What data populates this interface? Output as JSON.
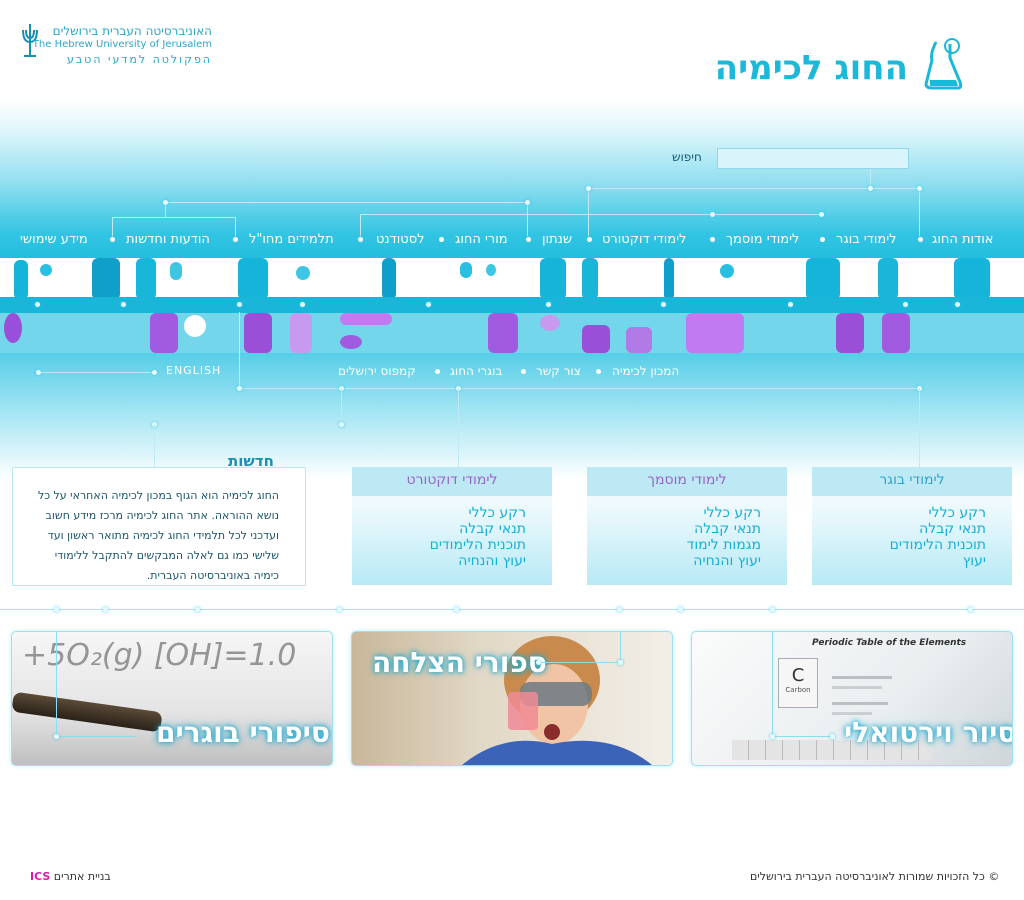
{
  "header": {
    "university_hebrew": "האוניברסיטה העברית בירושלים",
    "university_english": "The Hebrew University of Jerusalem",
    "faculty": "הפקולטה למדעי הטבע",
    "department_title": "החוג לכימיה"
  },
  "search": {
    "label": "חיפוש",
    "placeholder": "",
    "value": ""
  },
  "main_nav": [
    "אודות החוג",
    "לימודי בוגר",
    "לימודי מוסמך",
    "לימודי דוקטורט",
    "שנתון",
    "מורי החוג",
    "לסטודנט",
    "תלמידים מחו\"ל",
    "הודעות וחדשות",
    "מידע שימושי"
  ],
  "sub_nav": [
    "המכון לכימיה",
    "צור קשר",
    "בוגרי החוג",
    "קמפוס ירושלים"
  ],
  "english_link": "ENGLISH",
  "news": {
    "title": "חדשות",
    "text": "החוג לכימיה הוא הגוף במכון לכימיה האחראי על כל נושא ההוראה. אתר החוג לכימיה מרכז מידע חשוב ועדכני לכל תלמידי החוג לכימיה מתואר ראשון ועד שלישי כמו גם לאלה המבקשים להתקבל ללימודי כימיה באוניברסיטה העברית."
  },
  "programs": [
    {
      "title": "לימודי בוגר",
      "links": [
        "רקע כללי",
        "תנאי קבלה",
        "תוכנית הלימודים",
        "יעוץ"
      ]
    },
    {
      "title": "לימודי מוסמך",
      "links": [
        "רקע כללי",
        "תנאי קבלה",
        "מגמות לימוד",
        "יעוץ והנחיה"
      ]
    },
    {
      "title": "לימודי דוקטורט",
      "links": [
        "רקע כללי",
        "תנאי קבלה",
        "תוכנית הלימודים",
        "יעוץ והנחיה"
      ]
    }
  ],
  "features": [
    {
      "title": "סיור וירטואלי",
      "image": "periodic-table",
      "periodic_heading": "Periodic Table of the Elements",
      "element_symbol": "C",
      "element_name": "Carbon"
    },
    {
      "title": "ספורי הצלחה",
      "image": "student-with-beaker"
    },
    {
      "title": "סיפורי בוגרים",
      "image": "chemistry-formula-pen",
      "formula": "+5O₂(g) [OH]=1.0"
    }
  ],
  "footer": {
    "copyright": "© כל הזכויות שמורות לאוניברסיטה העברית בירושלים",
    "builder_text": "בניית אתרים",
    "builder_brand": "ICS"
  },
  "colors": {
    "accent": "#1bb8da",
    "dark_text": "#1b5468",
    "brand_pink": "#d61ea8"
  }
}
